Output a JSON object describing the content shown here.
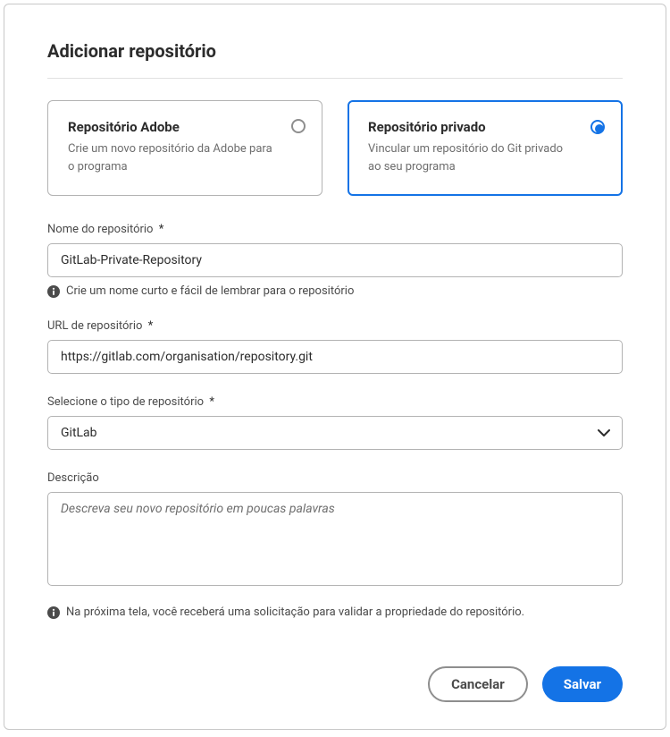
{
  "dialog": {
    "title": "Adicionar repositório"
  },
  "repoType": {
    "adobe": {
      "title": "Repositório Adobe",
      "desc": "Crie um novo repositório da Adobe para o programa"
    },
    "private": {
      "title": "Repositório privado",
      "desc": "Vincular um repositório do Git privado ao seu programa"
    }
  },
  "fields": {
    "name": {
      "label": "Nome do repositório",
      "value": "GitLab-Private-Repository",
      "hint": "Crie um nome curto e fácil de lembrar para o repositório"
    },
    "url": {
      "label": "URL de repositório",
      "value": "https://gitlab.com/organisation/repository.git"
    },
    "type": {
      "label": "Selecione o tipo de repositório",
      "value": "GitLab"
    },
    "description": {
      "label": "Descrição",
      "placeholder": "Descreva seu novo repositório em poucas palavras"
    }
  },
  "bottomHint": "Na próxima tela, você receberá uma solicitação para validar a propriedade do repositório.",
  "buttons": {
    "cancel": "Cancelar",
    "save": "Salvar"
  },
  "requiredMark": "*"
}
